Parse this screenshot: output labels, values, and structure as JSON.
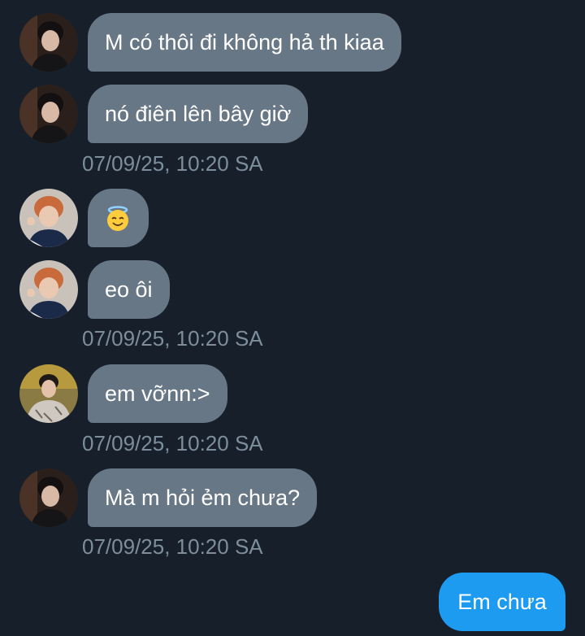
{
  "messages": [
    {
      "sender": "user-a",
      "text": "M có thôi đi không hả th kiaa"
    },
    {
      "sender": "user-a",
      "text": "nó điên lên bây giờ"
    },
    {
      "sender": "user-b",
      "emoji": "smiling-face-with-halo"
    },
    {
      "sender": "user-b",
      "text": "eo ôi"
    },
    {
      "sender": "user-c",
      "text": "em vỡnn:>"
    },
    {
      "sender": "user-a",
      "text": "Mà m hỏi ẻm chưa?"
    },
    {
      "sender": "me",
      "text": "Em chưa"
    }
  ],
  "timestamps": [
    "07/09/25, 10:20 SA",
    "07/09/25, 10:20 SA",
    "07/09/25, 10:20 SA",
    "07/09/25, 10:20 SA"
  ],
  "colors": {
    "background": "#17202a",
    "incoming_bubble": "#687786",
    "outgoing_bubble": "#1d9bf0",
    "timestamp": "#7d8d9c"
  }
}
